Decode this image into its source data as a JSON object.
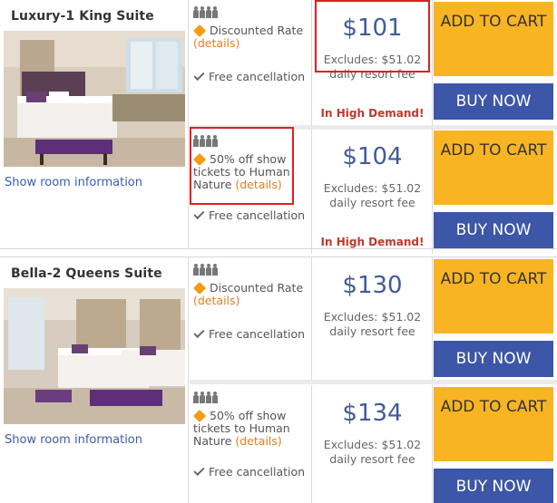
{
  "rooms": [
    {
      "title": "Luxury-1 King Suite",
      "show_info": "Show room information",
      "rates": [
        {
          "promo": "Discounted Rate",
          "details": "(details)",
          "cancel": "Free cancellation",
          "price": "$101",
          "excludes": "Excludes: $51.02 daily resort fee",
          "demand": "In High Demand!",
          "add_to_cart": "ADD TO CART",
          "buy_now": "BUY NOW"
        },
        {
          "promo": "50% off show tickets to Human Nature",
          "details": "(details)",
          "cancel": "Free cancellation",
          "price": "$104",
          "excludes": "Excludes: $51.02 daily resort fee",
          "demand": "In High Demand!",
          "add_to_cart": "ADD TO CART",
          "buy_now": "BUY NOW"
        }
      ]
    },
    {
      "title": "Bella-2 Queens Suite",
      "show_info": "Show room information",
      "rates": [
        {
          "promo": "Discounted Rate",
          "details": "(details)",
          "cancel": "Free cancellation",
          "price": "$130",
          "excludes": "Excludes: $51.02 daily resort fee",
          "add_to_cart": "ADD TO CART",
          "buy_now": "BUY NOW"
        },
        {
          "promo": "50% off show tickets to Human Nature",
          "details": "(details)",
          "cancel": "Free cancellation",
          "price": "$134",
          "excludes": "Excludes: $51.02 daily resort fee",
          "add_to_cart": "ADD TO CART",
          "buy_now": "BUY NOW"
        }
      ]
    }
  ],
  "colors": {
    "add_to_cart": "#f8b422",
    "buy_now": "#3c56a8",
    "price": "#3f5c9a",
    "demand": "#c0392b",
    "details_link": "#e67e22",
    "room_link": "#3a5da8",
    "highlight": "#e02020"
  },
  "icons": [
    "occupancy-icon",
    "tag-icon",
    "check-icon"
  ]
}
